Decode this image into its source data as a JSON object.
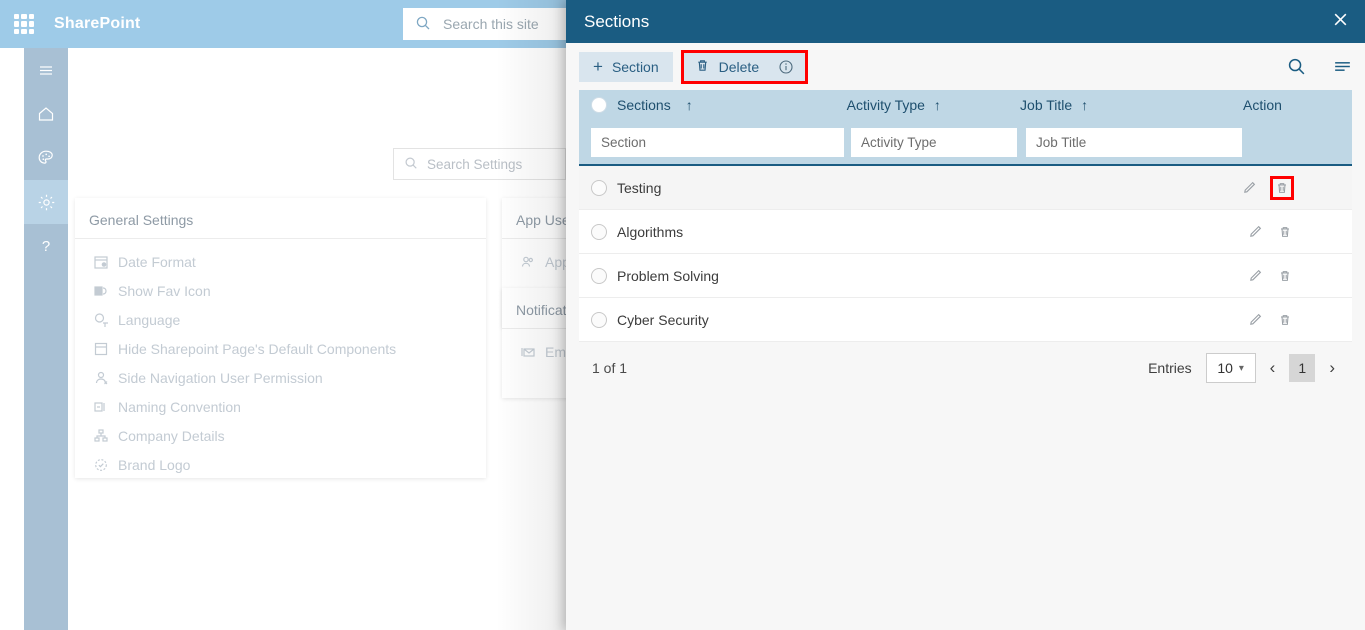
{
  "sharepoint": {
    "brand": "SharePoint",
    "waffle_icon": "app-launcher-icon",
    "search_placeholder": "Search this site",
    "search_icon": "search-icon"
  },
  "rail": {
    "items": [
      {
        "name": "menu",
        "icon": "hamburger-icon",
        "active": false
      },
      {
        "name": "home",
        "icon": "home-icon",
        "active": false
      },
      {
        "name": "theme",
        "icon": "palette-icon",
        "active": false
      },
      {
        "name": "settings",
        "icon": "gear-icon",
        "active": true
      },
      {
        "name": "help",
        "icon": "question-mark-icon",
        "active": false
      }
    ]
  },
  "settings_search": {
    "placeholder": "Search Settings",
    "icon": "search-icon"
  },
  "general_settings": {
    "title": "General Settings",
    "items": [
      {
        "label": "Date Format",
        "icon": "calendar-clock-icon"
      },
      {
        "label": "Show Fav Icon",
        "icon": "favicon-icon"
      },
      {
        "label": "Language",
        "icon": "translate-icon"
      },
      {
        "label": "Hide Sharepoint Page's Default Components",
        "icon": "layout-icon"
      },
      {
        "label": "Side Navigation User Permission",
        "icon": "user-permission-icon"
      },
      {
        "label": "Naming Convention",
        "icon": "naming-icon"
      },
      {
        "label": "Company Details",
        "icon": "org-chart-icon"
      },
      {
        "label": "Brand Logo",
        "icon": "badge-icon"
      }
    ]
  },
  "app_users_card": {
    "title": "App User(s)",
    "item_label": "App U",
    "item_icon": "people-icon"
  },
  "notifications_card": {
    "title": "Notificati",
    "item_label": "Email",
    "item_icon": "email-icon"
  },
  "panel": {
    "title": "Sections",
    "close_icon": "close-icon",
    "toolbar": {
      "add_label": "Section",
      "add_icon": "plus-icon",
      "delete_label": "Delete",
      "delete_icon": "trash-icon",
      "info_icon": "info-icon",
      "search_icon": "search-icon",
      "menu_icon": "list-menu-icon"
    },
    "grid": {
      "columns": [
        {
          "label": "Sections",
          "sort": "↑"
        },
        {
          "label": "Activity Type",
          "sort": "↑"
        },
        {
          "label": "Job Title",
          "sort": "↑"
        },
        {
          "label": "Action",
          "sort": ""
        }
      ],
      "filters": [
        {
          "placeholder": "Section",
          "value": "Section"
        },
        {
          "placeholder": "Activity Type",
          "value": "Activity Type"
        },
        {
          "placeholder": "Job Title",
          "value": "Job Title"
        }
      ],
      "rows": [
        {
          "section": "Testing",
          "activity_type": "",
          "job_title": ""
        },
        {
          "section": "Algorithms",
          "activity_type": "",
          "job_title": ""
        },
        {
          "section": "Problem Solving",
          "activity_type": "",
          "job_title": ""
        },
        {
          "section": "Cyber Security",
          "activity_type": "",
          "job_title": ""
        }
      ],
      "row_action_icons": {
        "edit": "pencil-icon",
        "delete": "trash-icon"
      }
    },
    "footer": {
      "count_text": "1 of 1",
      "entries_label": "Entries",
      "entries_value": "10",
      "prev_icon": "chevron-left-icon",
      "next_icon": "chevron-right-icon",
      "current_page": "1"
    }
  },
  "colors": {
    "panel_header": "#1a5c82",
    "grid_header": "#bfd7e5",
    "toolbar_button": "#d9e5ee",
    "highlight": "#ff0000",
    "sharepoint_bar": "#9ecbe8",
    "rail": "#a8c0d4"
  }
}
